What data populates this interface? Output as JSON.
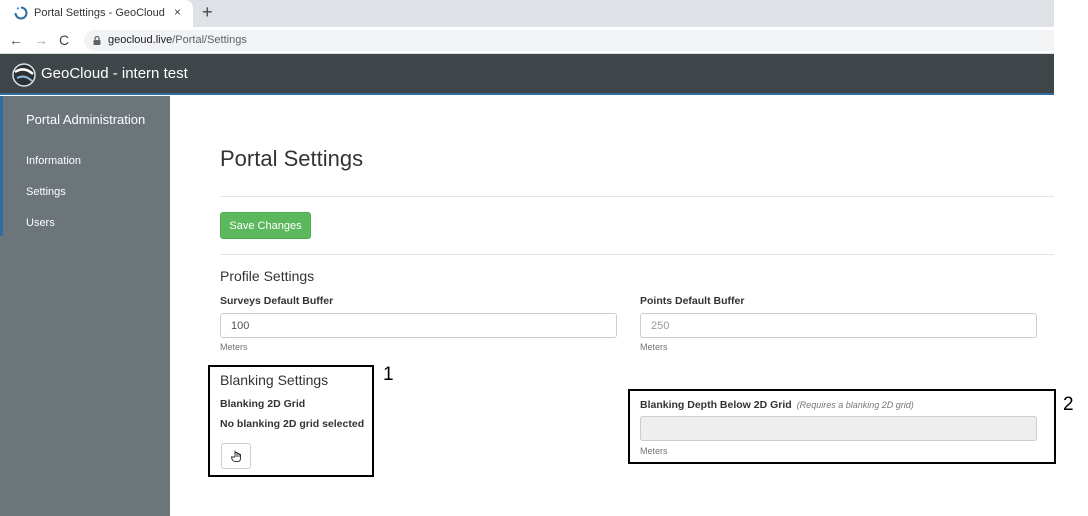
{
  "browser": {
    "tab_title": "Portal Settings - GeoCloud",
    "tab_close": "×",
    "new_tab": "+",
    "back": "←",
    "forward": "→",
    "reload": "C",
    "url_host": "geocloud.live",
    "url_path": "/Portal/Settings"
  },
  "app": {
    "title": "GeoCloud - intern test",
    "accent_color": "#2e6da4"
  },
  "sidebar": {
    "heading": "Portal Administration",
    "items": [
      {
        "label": "Information"
      },
      {
        "label": "Settings"
      },
      {
        "label": "Users"
      }
    ]
  },
  "main": {
    "page_title": "Portal Settings",
    "save_label": "Save Changes",
    "profile": {
      "title": "Profile Settings",
      "surveys_label": "Surveys Default Buffer",
      "surveys_value": "100",
      "surveys_unit": "Meters",
      "points_label": "Points Default Buffer",
      "points_placeholder": "250",
      "points_unit": "Meters"
    },
    "blanking": {
      "title": "Blanking Settings",
      "grid_label": "Blanking 2D Grid",
      "grid_value": "No blanking 2D grid selected",
      "select_icon": "pointer-hand-icon",
      "depth_label": "Blanking Depth Below 2D Grid",
      "depth_note": "(Requires a blanking 2D grid)",
      "depth_unit": "Meters"
    }
  },
  "annotations": {
    "one": "1",
    "two": "2"
  }
}
